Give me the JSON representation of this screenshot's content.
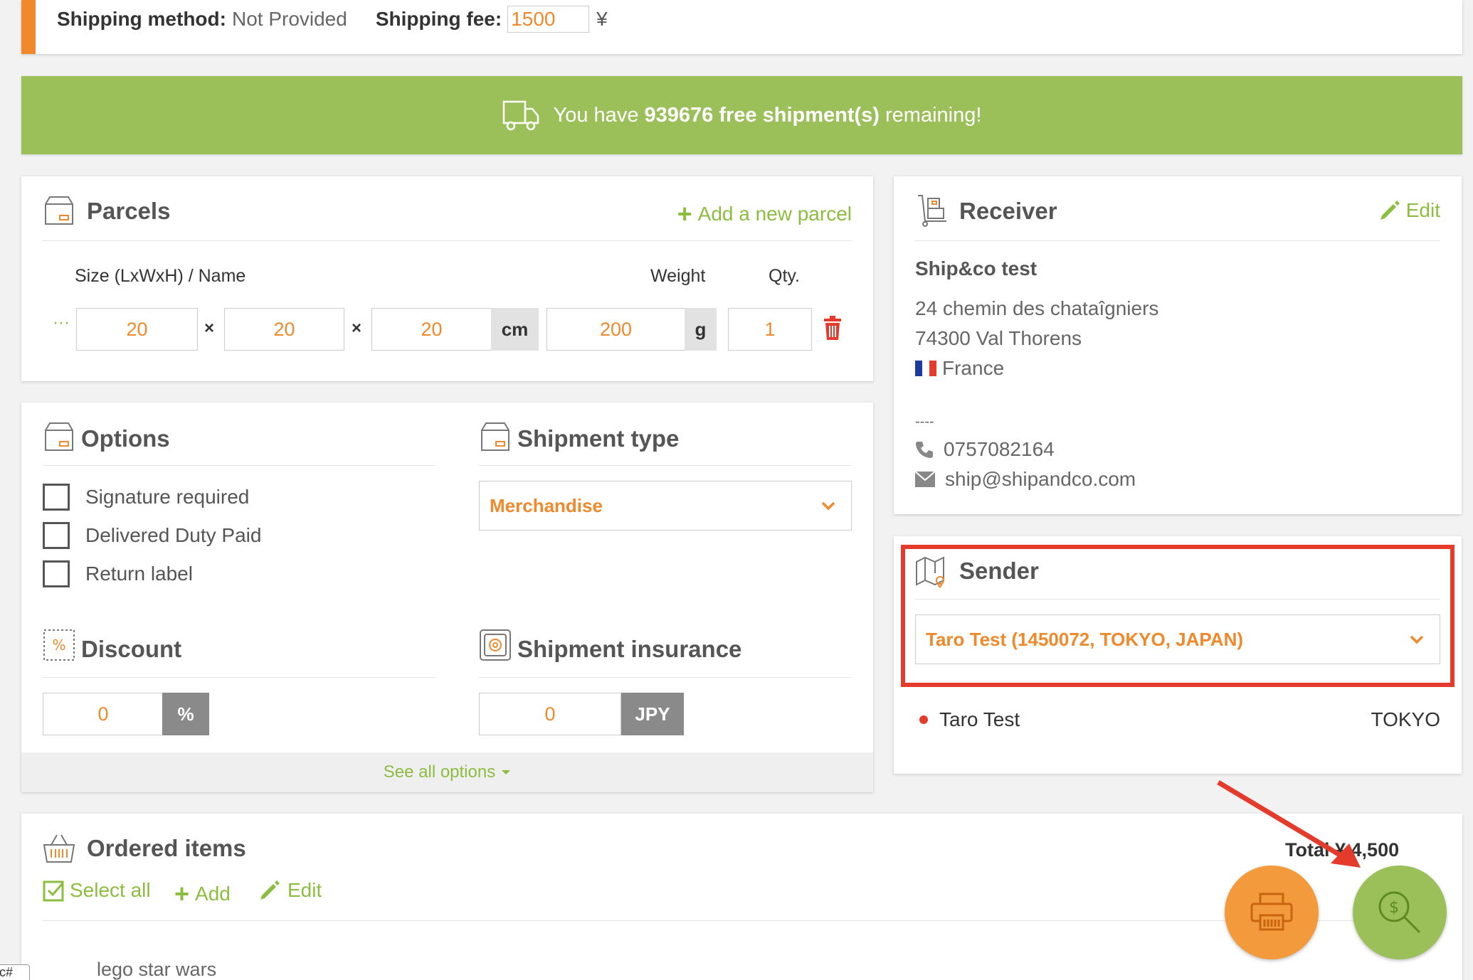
{
  "topbar": {
    "shipping_method_label": "Shipping method:",
    "shipping_method_value": "Not Provided",
    "shipping_fee_label": "Shipping fee:",
    "shipping_fee_value": "1500",
    "currency_symbol": "¥"
  },
  "banner": {
    "prefix": "You have",
    "count": "939676 free shipment(s)",
    "suffix": "remaining!"
  },
  "parcels": {
    "title": "Parcels",
    "add_label": "Add a new parcel",
    "col_size": "Size (LxWxH) / Name",
    "col_weight": "Weight",
    "col_qty": "Qty.",
    "handle": "···",
    "times": "×",
    "length": "20",
    "width": "20",
    "height": "20",
    "size_unit": "cm",
    "weight": "200",
    "weight_unit": "g",
    "qty": "1"
  },
  "options": {
    "title": "Options",
    "items": [
      {
        "label": "Signature required",
        "checked": false
      },
      {
        "label": "Delivered Duty Paid",
        "checked": false
      },
      {
        "label": "Return label",
        "checked": false
      }
    ],
    "shipment_type_title": "Shipment type",
    "shipment_type_value": "Merchandise",
    "discount_title": "Discount",
    "discount_value": "0",
    "discount_unit": "%",
    "insurance_title": "Shipment insurance",
    "insurance_value": "0",
    "insurance_unit": "JPY",
    "see_all": "See all options"
  },
  "receiver": {
    "title": "Receiver",
    "edit_label": "Edit",
    "name": "Ship&co test",
    "address1": "24 chemin des chataîgniers",
    "address2": "74300 Val Thorens",
    "country": "France",
    "separator": "----",
    "phone": "0757082164",
    "email": "ship@shipandco.com"
  },
  "sender": {
    "title": "Sender",
    "selected": "Taro Test (1450072, TOKYO, JAPAN)",
    "name": "Taro Test",
    "city": "TOKYO"
  },
  "ordered": {
    "title": "Ordered items",
    "total_label": "Total",
    "total_value": "¥ 4,500",
    "select_all": "Select all",
    "add": "Add",
    "edit": "Edit",
    "first_item": "lego star wars"
  },
  "corner_tag": "c#",
  "colors": {
    "accent_orange": "#f0892c",
    "accent_green": "#8cbd3f",
    "banner_green": "#9bc05a",
    "highlight_red": "#e53b2c"
  }
}
